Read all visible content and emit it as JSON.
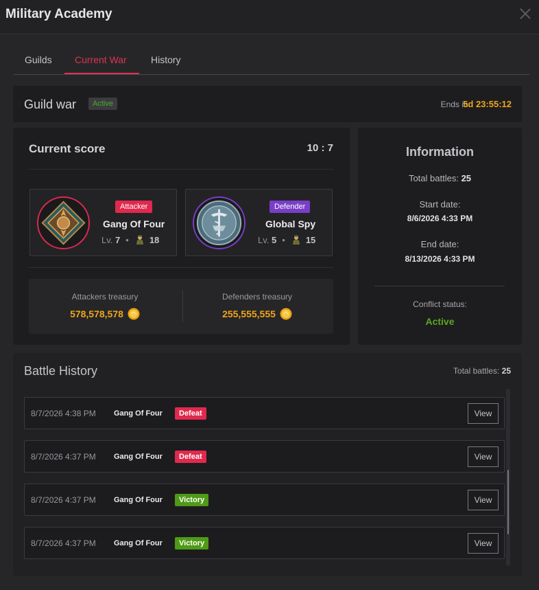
{
  "window": {
    "title": "Military Academy"
  },
  "tabs": [
    {
      "label": "Guilds"
    },
    {
      "label": "Current War"
    },
    {
      "label": "History"
    }
  ],
  "guild_war": {
    "title": "Guild war",
    "status_badge": "Active",
    "ends_label": "Ends in:",
    "ends_value": "5d 23:55:12"
  },
  "score": {
    "title": "Current score",
    "value": "10 : 7",
    "attacker": {
      "role": "Attacker",
      "name": "Gang Of Four",
      "level_label": "Lv.",
      "level": "7",
      "members": "18",
      "role_color": "#e0294d",
      "ring_color": "#e0294d"
    },
    "defender": {
      "role": "Defender",
      "name": "Global Spy",
      "level_label": "Lv.",
      "level": "5",
      "members": "15",
      "role_color": "#7a3ec8",
      "ring_color": "#7a3ec8"
    },
    "treasury": {
      "attackers_label": "Attackers treasury",
      "attackers_value": "578,578,578",
      "defenders_label": "Defenders treasury",
      "defenders_value": "255,555,555"
    }
  },
  "information": {
    "title": "Information",
    "total_battles_label": "Total battles:",
    "total_battles": "25",
    "start_label": "Start date:",
    "start_value": "8/6/2026 4:33 PM",
    "end_label": "End date:",
    "end_value": "8/13/2026 4:33 PM",
    "conflict_label": "Conflict status:",
    "conflict_value": "Active"
  },
  "battle_history": {
    "title": "Battle History",
    "total_label": "Total battles:",
    "total_value": "25",
    "view_label": "View",
    "rows": [
      {
        "date": "8/7/2026 4:38 PM",
        "guild": "Gang Of Four",
        "result": "Defeat"
      },
      {
        "date": "8/7/2026 4:37 PM",
        "guild": "Gang Of Four",
        "result": "Defeat"
      },
      {
        "date": "8/7/2026 4:37 PM",
        "guild": "Gang Of Four",
        "result": "Victory"
      },
      {
        "date": "8/7/2026 4:37 PM",
        "guild": "Gang Of Four",
        "result": "Victory"
      }
    ]
  },
  "colors": {
    "accent": "#e0334f",
    "gold": "#f0a51a",
    "active_green": "#4caf1e",
    "defeat": "#e0294d",
    "victory": "#4f9a16"
  }
}
